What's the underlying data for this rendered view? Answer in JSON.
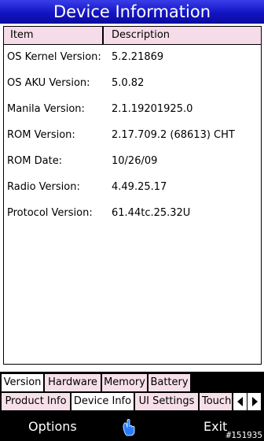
{
  "window": {
    "title": "Device Information"
  },
  "list": {
    "columns": [
      "Item",
      "Description"
    ],
    "rows": [
      {
        "item": "OS Kernel Version:",
        "description": "5.2.21869"
      },
      {
        "item": "OS AKU Version:",
        "description": "5.0.82"
      },
      {
        "item": "Manila Version:",
        "description": "2.1.19201925.0"
      },
      {
        "item": "ROM Version:",
        "description": "2.17.709.2 (68613) CHT"
      },
      {
        "item": "ROM Date:",
        "description": "10/26/09"
      },
      {
        "item": "Radio Version:",
        "description": "4.49.25.17"
      },
      {
        "item": "Protocol Version:",
        "description": "61.44tc.25.32U"
      }
    ]
  },
  "tabs_top": [
    {
      "label": "Version",
      "active": true
    },
    {
      "label": "Hardware",
      "active": false
    },
    {
      "label": "Memory",
      "active": false
    },
    {
      "label": "Battery",
      "active": false
    }
  ],
  "tabs_bottom": [
    {
      "label": "Product Info",
      "active": false
    },
    {
      "label": "Device Info",
      "active": true
    },
    {
      "label": "UI Settings",
      "active": false
    },
    {
      "label": "Touch",
      "active": false
    }
  ],
  "softkeys": {
    "left": "Options",
    "middle_icon": "touch-hand-icon",
    "right": "Exit"
  },
  "watermark": "#151935",
  "colors": {
    "title_bar": "#1a1cc8",
    "header_bg": "#f6dce8",
    "tab_bg": "#f7dfe9"
  }
}
